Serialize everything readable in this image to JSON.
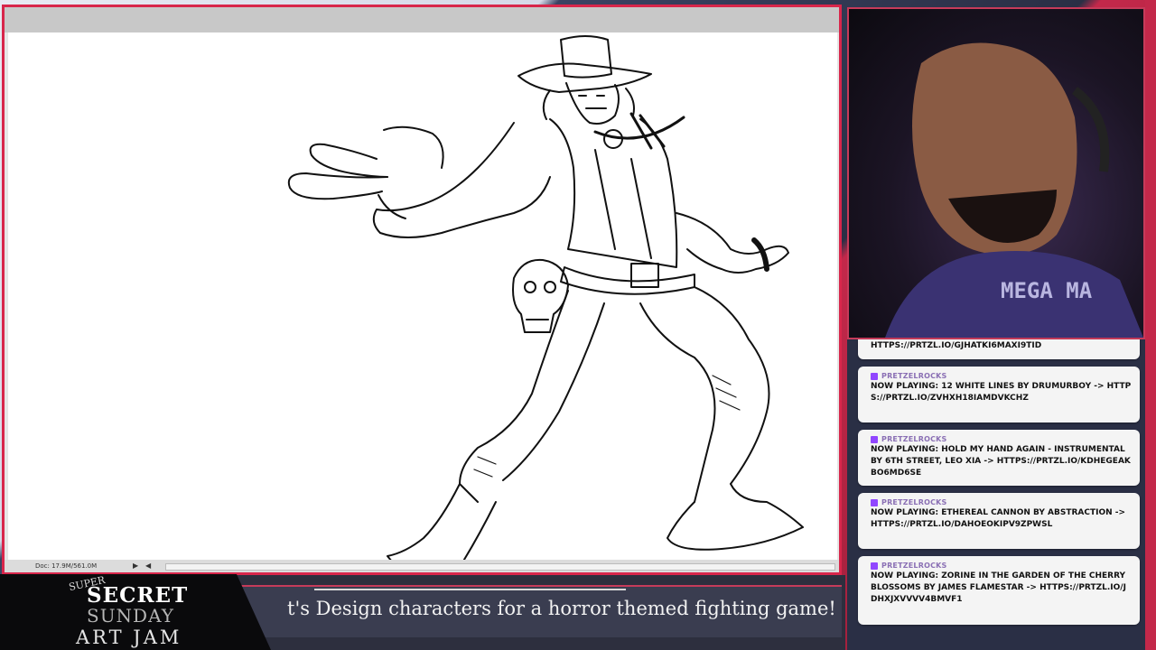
{
  "canvas": {
    "status_doc": "Doc: 17.9M/561.0M",
    "status_arrow": "▶",
    "status_nav": "◀"
  },
  "overlay": {
    "marquee_text": "t's Design characters for a horror themed fighting game!",
    "logo": {
      "super": "SUPER",
      "secret": "SECRET",
      "sunday": "SUNDAY",
      "art_jam": "ART JAM"
    }
  },
  "webcam": {
    "shirt_text": "MEGA MA"
  },
  "chat": {
    "messages": [
      {
        "user": "",
        "text": "HTTPS://PRTZL.IO/GJHATKI6MAXI9TID"
      },
      {
        "user": "PRETZELROCKS",
        "text": "NOW PLAYING: 12 WHITE LINES BY DRUMURBOY -> HTTPS://PRTZL.IO/ZVHXH18IAMDVKCHZ"
      },
      {
        "user": "PRETZELROCKS",
        "text": "NOW PLAYING: HOLD MY HAND AGAIN - INSTRUMENTAL BY 6TH STREET, LEO XIA -> HTTPS://PRTZL.IO/KDHEGEAKBO6MD6SE"
      },
      {
        "user": "PRETZELROCKS",
        "text": "NOW PLAYING: ETHEREAL CANNON BY ABSTRACTION -> HTTPS://PRTZL.IO/DAHOEOKIPV9ZPWSL"
      },
      {
        "user": "PRETZELROCKS",
        "text": "NOW PLAYING: ZORINE IN THE GARDEN OF THE CHERRY BLOSSOMS BY JAMES FLAMESTAR -> HTTPS://PRTZL.IO/JDHXJXVVVV4BMVF1"
      }
    ]
  },
  "colors": {
    "accent": "#d8264b",
    "chat_user": "#8a6fb4",
    "panel": "#2d2f3e"
  }
}
